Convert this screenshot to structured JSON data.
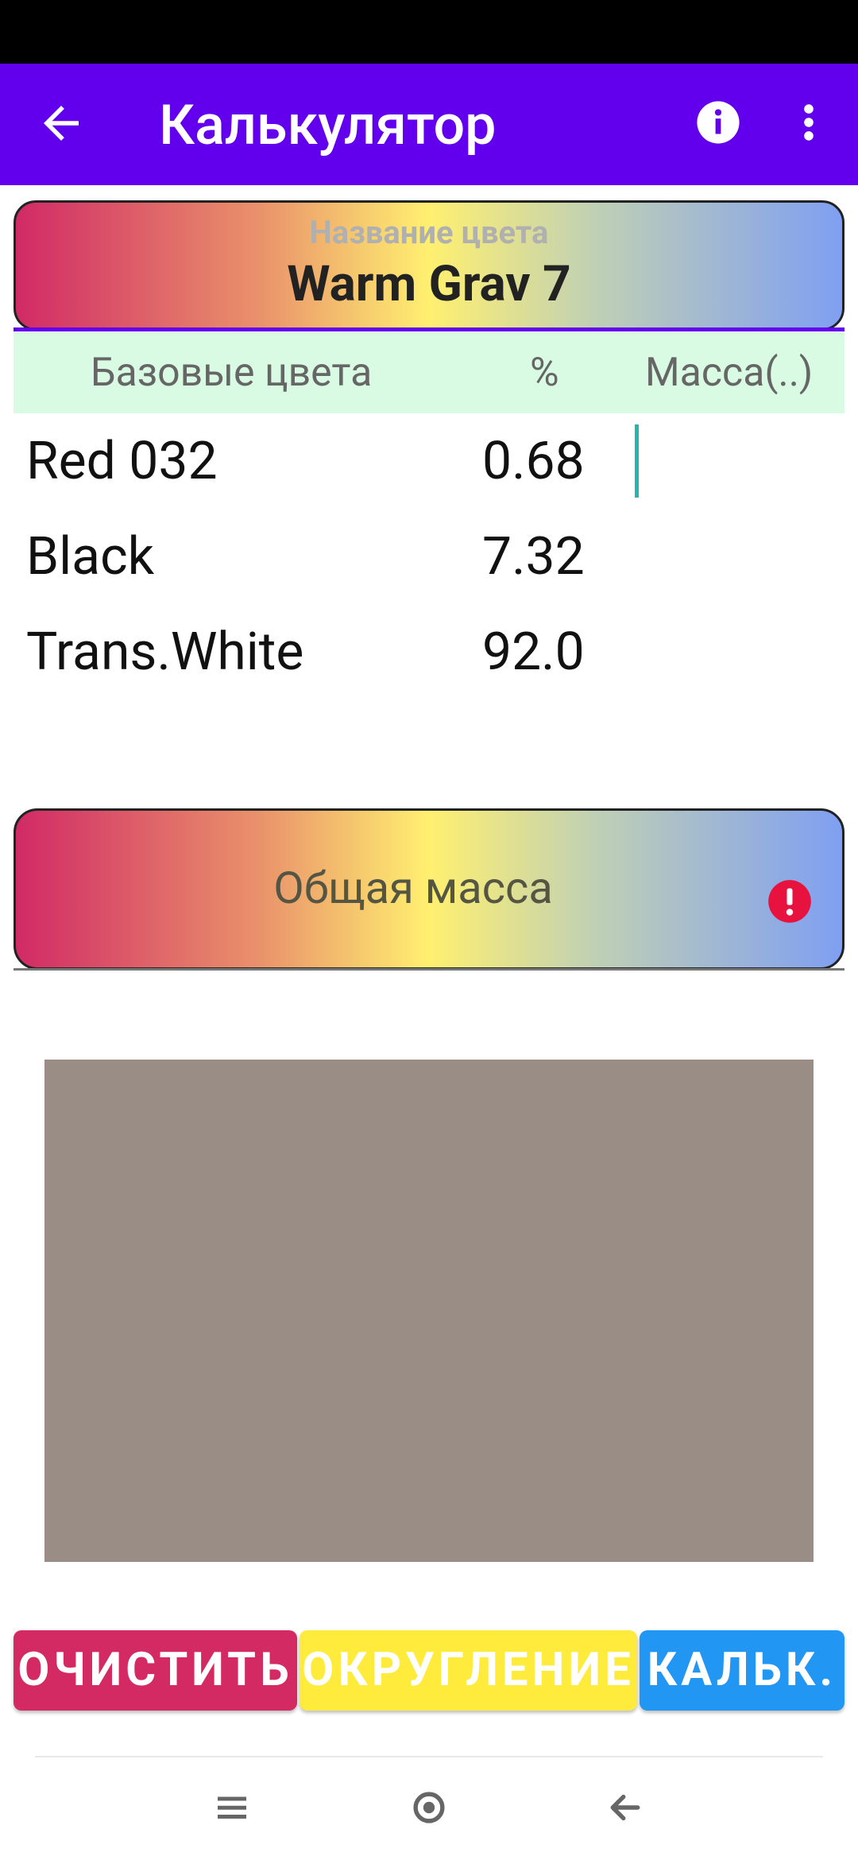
{
  "app_bar": {
    "title": "Калькулятор"
  },
  "color_name": {
    "label": "Название цвета",
    "value": "Warm Grav 7"
  },
  "table": {
    "headers": {
      "base": "Базовые цвета",
      "percent": "%",
      "mass": "Масса(..)"
    },
    "rows": [
      {
        "name": "Red 032",
        "percent": "0.68",
        "mass": ""
      },
      {
        "name": "Black",
        "percent": "7.32",
        "mass": ""
      },
      {
        "name": "Trans.White",
        "percent": "92.0",
        "mass": ""
      }
    ]
  },
  "total": {
    "label": "Общая масса"
  },
  "preview": {
    "color": "#9a8d85"
  },
  "buttons": {
    "clear": "ОЧИСТИТЬ",
    "round": "ОКРУГЛЕНИЕ",
    "calc": "КАЛЬК."
  },
  "colors": {
    "primary": "#6200EE",
    "alert": "#e8123f"
  },
  "icons": {
    "back": "arrow-back-icon",
    "info": "info-icon",
    "more": "more-vert-icon",
    "alert": "error-icon"
  }
}
